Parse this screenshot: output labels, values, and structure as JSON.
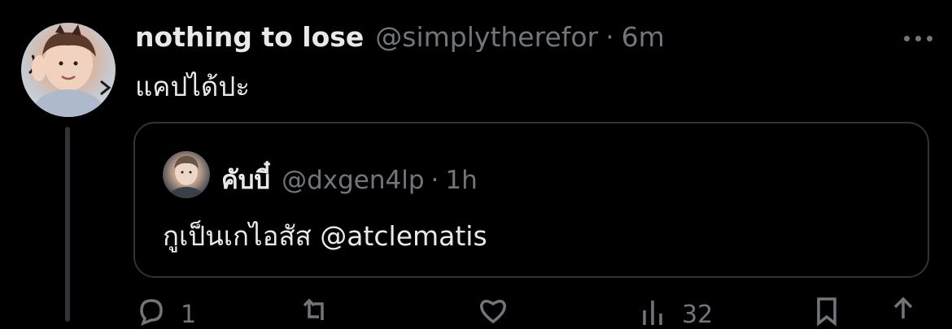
{
  "tweet": {
    "display_name": "nothing to lose",
    "handle": "@simplytherefor",
    "separator": "·",
    "time": "6m",
    "text": "แคปได้ปะ",
    "avatar_icon": "avatar-photo"
  },
  "quote": {
    "display_name": "คับบี๋",
    "handle": "@dxgen4lp",
    "separator": "·",
    "time": "1h",
    "text": "กูเป็นเกไอสัส @atclematis",
    "avatar_icon": "avatar-photo"
  },
  "actions": {
    "reply_count": "1",
    "retweet_count": "",
    "like_count": "",
    "views_count": "32"
  },
  "colors": {
    "background": "#000000",
    "primary_text": "#e7e9ea",
    "secondary_text": "#71767b",
    "border": "#2f3336"
  }
}
